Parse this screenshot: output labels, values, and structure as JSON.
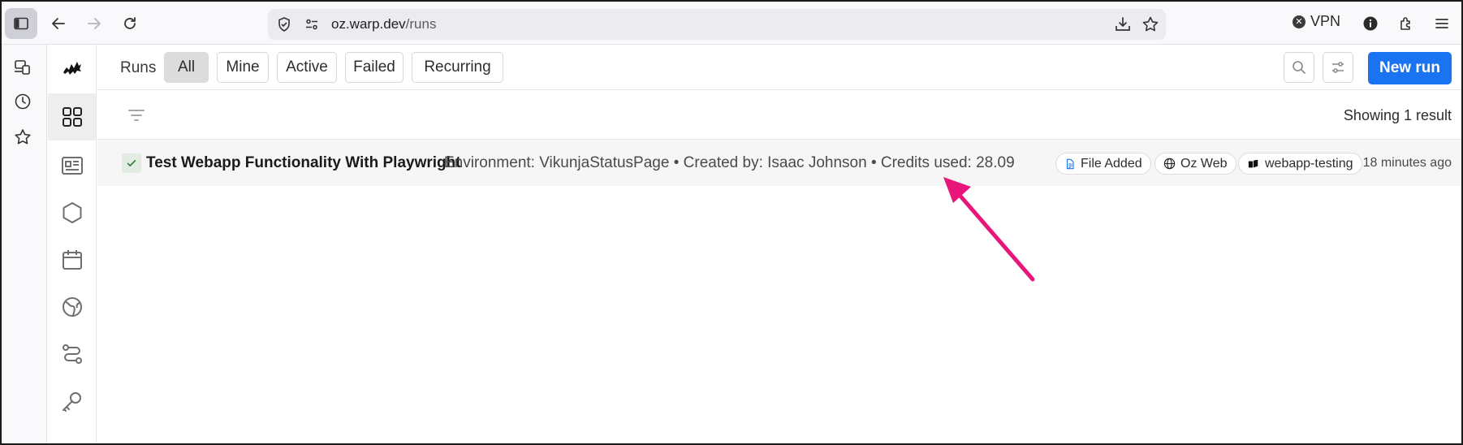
{
  "browser": {
    "url_host": "oz.warp.dev",
    "url_path": "/runs",
    "vpn_label": "VPN"
  },
  "toolbar": {
    "runs_label": "Runs",
    "filters": [
      {
        "label": "All",
        "active": true
      },
      {
        "label": "Mine",
        "active": false
      },
      {
        "label": "Active",
        "active": false
      },
      {
        "label": "Failed",
        "active": false
      },
      {
        "label": "Recurring",
        "active": false
      }
    ],
    "new_run_label": "New run"
  },
  "results": {
    "count_text": "Showing 1 result"
  },
  "runs": [
    {
      "status": "success",
      "title": "Test Webapp Functionality With Playwright",
      "meta": "Environment: VikunjaStatusPage • Created by: Isaac Johnson • Credits used: 28.09",
      "tags": [
        {
          "label": "File Added",
          "icon": "file-icon"
        },
        {
          "label": "Oz Web",
          "icon": "globe-icon"
        },
        {
          "label": "webapp-testing",
          "icon": "skill-icon"
        }
      ],
      "time": "18 minutes ago"
    }
  ],
  "colors": {
    "accent": "#1a73f0",
    "annotation_arrow": "#e8157a",
    "success": "#2e7d32"
  }
}
